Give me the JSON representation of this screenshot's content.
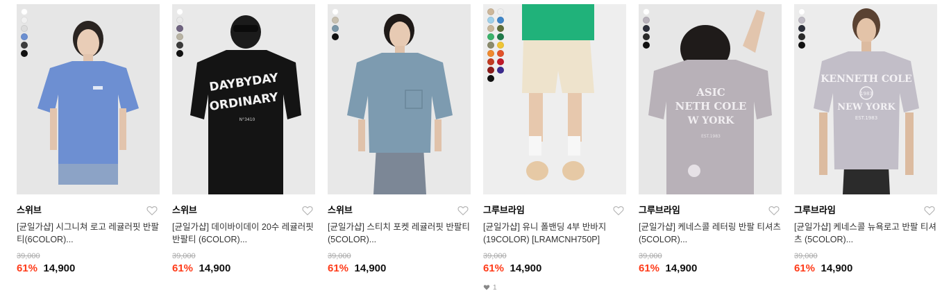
{
  "products": [
    {
      "brand": "스위브",
      "title": "[균일가샵] 시그니쳐 로고 레귤러핏 반팔티(6COLOR)...",
      "original_price": "39,000",
      "discount": "61%",
      "price": "14,900",
      "likes": "",
      "swatches": [
        "#ffffff",
        "#f1f1f1",
        "#dcdcdc",
        "#6b8fd1",
        "#3c3c3c",
        "#111111"
      ],
      "image": "blue oversized t-shirt on model"
    },
    {
      "brand": "스위브",
      "title": "[균일가샵] 데이바이데이 20수 레귤러핏 반팔티 (6COLOR)...",
      "original_price": "39,000",
      "discount": "61%",
      "price": "14,900",
      "likes": "",
      "swatches": [
        "#ffffff",
        "#e9e9e9",
        "#6f6380",
        "#b9b4a4",
        "#3a3a3a",
        "#111111"
      ],
      "image": "black graphic t-shirt back view"
    },
    {
      "brand": "스위브",
      "title": "[균일가샵] 스티치 포켓 레귤러핏 반팔티 (5COLOR)...",
      "original_price": "39,000",
      "discount": "61%",
      "price": "14,900",
      "likes": "",
      "swatches": [
        "#ffffff",
        "#c8c0b0",
        "#7b97a8",
        "#111111"
      ],
      "image": "blue grey pocket t-shirt on model"
    },
    {
      "brand": "그루브라임",
      "title": "[균일가샵] 유니 폴밴딩 4부 반바지 (19COLOR) [LRAMCNH750P]",
      "original_price": "39,000",
      "discount": "61%",
      "price": "14,900",
      "likes": "1",
      "swatches": [
        "#cdb79a",
        "#eeeeee",
        "#9fd0ea",
        "#3f86c9",
        "#c8b79a",
        "#5f6e3a",
        "#3bb36b",
        "#1f7a4a",
        "#8b8b6b",
        "#efc535",
        "#f08a2f",
        "#e2532a",
        "#c23b22",
        "#c01a2a",
        "#8e1b1b",
        "#3b2a8f",
        "#111111"
      ],
      "image": "beige shorts with sneakers"
    },
    {
      "brand": "그루브라임",
      "title": "[균일가샵] 케네스콜 레터링 반팔 티셔츠 (5COLOR)...",
      "original_price": "39,000",
      "discount": "61%",
      "price": "14,900",
      "likes": "",
      "swatches": [
        "#ffffff",
        "#b9b3bc",
        "#2c2f3a",
        "#2a2a2a",
        "#111111"
      ],
      "image": "grey lettering t-shirt back view"
    },
    {
      "brand": "그루브라임",
      "title": "[균일가샵] 케네스콜 뉴욕로고 반팔 티셔츠 (5COLOR)...",
      "original_price": "39,000",
      "discount": "61%",
      "price": "14,900",
      "likes": "",
      "swatches": [
        "#ffffff",
        "#c0bcc6",
        "#2c2f3a",
        "#2a2a2a",
        "#111111"
      ],
      "image": "grey new york logo t-shirt"
    }
  ],
  "colors": {
    "discount": "#ff3b19",
    "brand_text": "#000000",
    "title_text": "#333333",
    "strike_price": "#a8a8a8"
  }
}
